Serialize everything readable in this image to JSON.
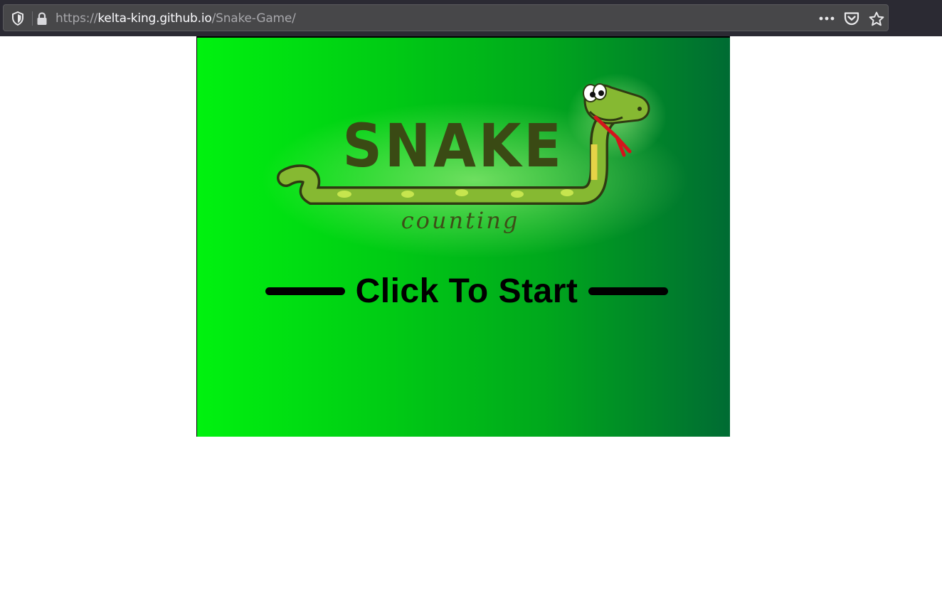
{
  "browser": {
    "url_scheme": "https://",
    "url_host": "kelta-king.github.io",
    "url_path": "/Snake-Game/",
    "icons": [
      "shield-icon",
      "lock-icon",
      "more-icon",
      "pocket-icon",
      "bookmark-star-icon"
    ]
  },
  "game": {
    "logo_title": "SNAKE",
    "logo_subtitle": "counting",
    "start_label": "Click To Start",
    "colors": {
      "gradient_left": "#00f20f",
      "gradient_right": "#006b33",
      "snake_body": "#7fb32c",
      "snake_outline": "#2f3a12",
      "tongue": "#d4141c"
    }
  }
}
